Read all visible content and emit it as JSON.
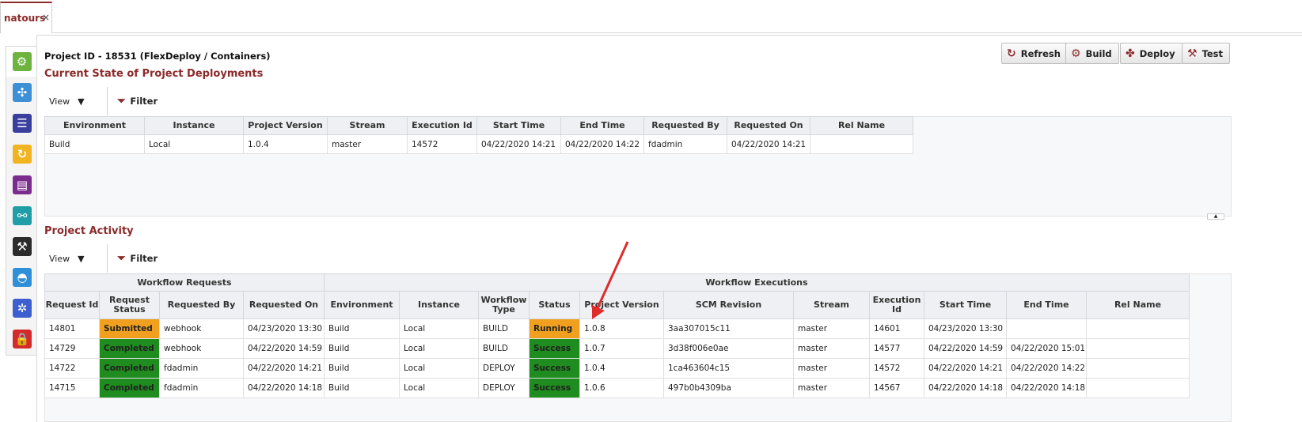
{
  "tab": {
    "label": "natours",
    "close": "×"
  },
  "rail": [
    {
      "name": "rail-project-icon",
      "color": "#6cb33f",
      "glyph": "⚙"
    },
    {
      "name": "rail-network-icon",
      "color": "#3d8fd6",
      "glyph": "✣"
    },
    {
      "name": "rail-list-icon",
      "color": "#3a3f9e",
      "glyph": "☰"
    },
    {
      "name": "rail-refresh-icon",
      "color": "#f2b320",
      "glyph": "↻"
    },
    {
      "name": "rail-report-icon",
      "color": "#7b2d8e",
      "glyph": "▤"
    },
    {
      "name": "rail-share-icon",
      "color": "#1f9ea8",
      "glyph": "⚯"
    },
    {
      "name": "rail-robot-icon",
      "color": "#2b2b2b",
      "glyph": "⚒"
    },
    {
      "name": "rail-docker-icon",
      "color": "#2f8fd8",
      "glyph": "◓"
    },
    {
      "name": "rail-kubernetes-icon",
      "color": "#3d5fcf",
      "glyph": "✲"
    },
    {
      "name": "rail-lock-icon",
      "color": "#d32b2b",
      "glyph": "🔒"
    }
  ],
  "header": {
    "project_id": "Project ID - 18531 (FlexDeploy / Containers)",
    "deployments_title": "Current State of Project Deployments",
    "activity_title": "Project Activity"
  },
  "buttons": {
    "refresh": "Refresh",
    "build": "Build",
    "deploy": "Deploy",
    "test": "Test"
  },
  "toolbar": {
    "view": "View",
    "filter": "Filter"
  },
  "deployments": {
    "columns": [
      "Environment",
      "Instance",
      "Project Version",
      "Stream",
      "Execution Id",
      "Start Time",
      "End Time",
      "Requested By",
      "Requested On",
      "Rel Name"
    ],
    "rows": [
      [
        "Build",
        "Local",
        "1.0.4",
        "master",
        "14572",
        "04/22/2020 14:21",
        "04/22/2020 14:22",
        "fdadmin",
        "04/22/2020 14:21",
        ""
      ]
    ]
  },
  "activity": {
    "group_requests": "Workflow Requests",
    "group_executions": "Workflow Executions",
    "columns": [
      "Request Id",
      "Request Status",
      "Requested By",
      "Requested On",
      "Environment",
      "Instance",
      "Workflow Type",
      "Status",
      "Project Version",
      "SCM Revision",
      "Stream",
      "Execution Id",
      "Start Time",
      "End Time",
      "Rel Name"
    ],
    "rows": [
      [
        "14801",
        "Submitted",
        "webhook",
        "04/23/2020 13:30",
        "Build",
        "Local",
        "BUILD",
        "Running",
        "1.0.8",
        "3aa307015c11",
        "master",
        "14601",
        "04/23/2020 13:30",
        "",
        ""
      ],
      [
        "14729",
        "Completed",
        "webhook",
        "04/22/2020 14:59",
        "Build",
        "Local",
        "BUILD",
        "Success",
        "1.0.7",
        "3d38f006e0ae",
        "master",
        "14577",
        "04/22/2020 14:59",
        "04/22/2020 15:01",
        ""
      ],
      [
        "14722",
        "Completed",
        "fdadmin",
        "04/22/2020 14:21",
        "Build",
        "Local",
        "DEPLOY",
        "Success",
        "1.0.4",
        "1ca463604c15",
        "master",
        "14572",
        "04/22/2020 14:21",
        "04/22/2020 14:22",
        ""
      ],
      [
        "14715",
        "Completed",
        "fdadmin",
        "04/22/2020 14:18",
        "Build",
        "Local",
        "DEPLOY",
        "Success",
        "1.0.6",
        "497b0b4309ba",
        "master",
        "14567",
        "04/22/2020 14:18",
        "04/22/2020 14:18",
        ""
      ]
    ]
  },
  "colors": {
    "accent": "#8c2a2a",
    "success": "#1e8c1e",
    "warning": "#f0a01e",
    "annotation_arrow": "#e02b2b"
  }
}
